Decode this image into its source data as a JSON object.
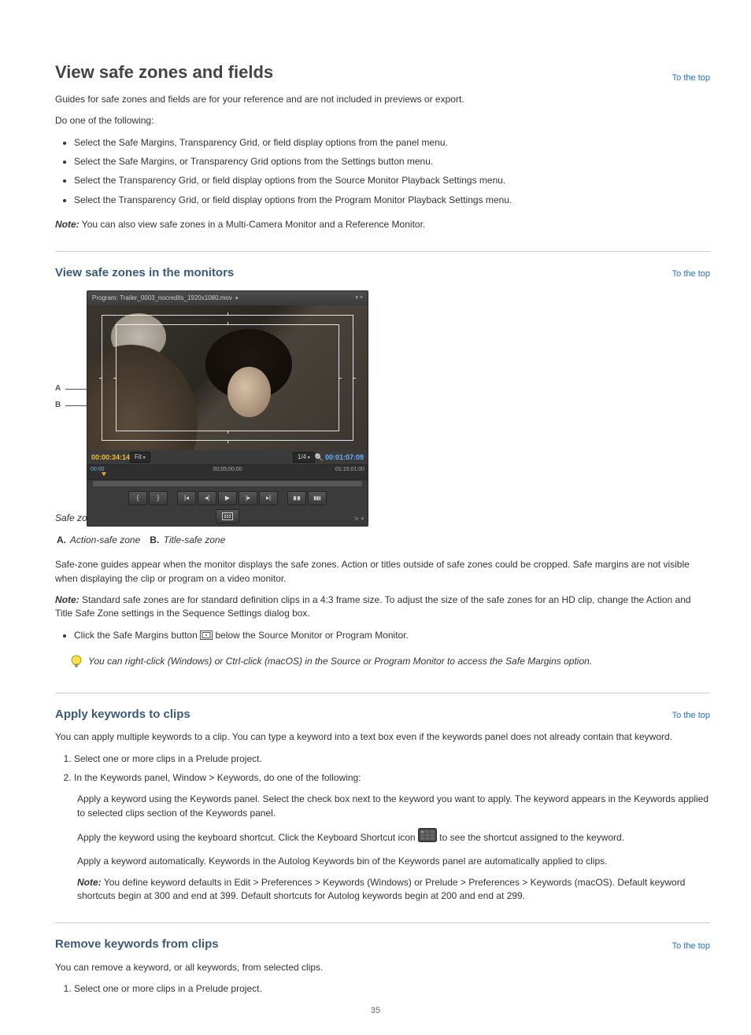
{
  "headings": {
    "h1": "View safe zones and fields",
    "h2_safezones": "View safe zones in the monitors",
    "h2_keywords": "Apply keywords to clips",
    "h2_remove": "Remove keywords from clips",
    "totop": "To the top"
  },
  "paras": {
    "intro": "Guides for safe zones and fields are for your reference and are not included in previews or export.",
    "do_one": "Do one of the following:",
    "remove_intro": "You can remove a keyword, or all keywords, from selected clips."
  },
  "list_safe_options": [
    "Select the Safe Margins, Transparency Grid, or field display options from the panel menu.",
    "Select the Safe Margins, or Transparency Grid options from the Settings button menu.",
    "Select the Transparency Grid, or field display options from the Source Monitor Playback Settings menu.",
    "Select the Transparency Grid, or field display options from the Program Monitor Playback Settings menu."
  ],
  "note1_label": "Note:",
  "note1_text": "You can also view safe zones in a Multi-Camera Monitor and a Reference Monitor.",
  "monitor": {
    "title": "Program: Trailer_0003_nocredits_1920x1080.mov",
    "tc_left": "00:00:34:14",
    "fit_label": "Fit",
    "zoom_label": "1/4",
    "tc_right": "00:01:07:09",
    "ruler_left": "00:00",
    "ruler_center": "00;05;00;00",
    "ruler_right": "01:15:01:00"
  },
  "fig_caption": "Safe zones in Program Monitor",
  "fig_key": {
    "A": "Action-safe zone",
    "B": "Title-safe zone"
  },
  "kw_intro": "You can apply multiple keywords to a clip. You can type a keyword into a text box even if the keywords panel does not already contain that keyword.",
  "kw_steps": [
    "Select one or more clips in a Prelude project.",
    "In the Keywords panel, Window > Keywords, do one of the following:"
  ],
  "view_sz_intro": "Safe-zone guides appear when the monitor displays the safe zones. Action or titles outside of safe zones could be cropped. Safe margins are not visible when displaying the clip or program on a video monitor.",
  "note2_label": "Note:",
  "note2_text": "Standard safe zones are for standard definition clips in a 4:3 frame size. To adjust the size of the safe zones for an HD clip, change the Action and Title Safe Zone settings in the Sequence Settings dialog box.",
  "view_sz_bullet_pre": "Click the Safe Margins button",
  "view_sz_bullet_post": "below the Source Monitor or Program Monitor.",
  "tip": "You can right-click (Windows) or Ctrl-click (macOS) in the Source or Program Monitor to access the Safe Margins option.",
  "kw_apply": {
    "intro2": "Apply a keyword using the Keywords panel. Select the check box next to the keyword you want to apply. The keyword appears in the Keywords applied to selected clips section of the Keywords panel.",
    "icon_pre": "Apply the keyword using the keyboard shortcut. Click the Keyboard Shortcut icon",
    "icon_post": "to see the shortcut assigned to the keyword.",
    "auto": "Apply a keyword automatically. Keywords in the Autolog Keywords bin of the Keywords panel are automatically applied to clips.",
    "shortnote_label": "Note:",
    "shortnote": "You define keyword defaults in Edit > Preferences > Keywords (Windows) or Prelude > Preferences > Keywords (macOS). Default keyword shortcuts begin at 300 and end at 399. Default shortcuts for Autolog keywords begin at 200 and end at 299."
  },
  "remove_bullet": "Select one or more clips in a Prelude project.",
  "page_number": "35"
}
